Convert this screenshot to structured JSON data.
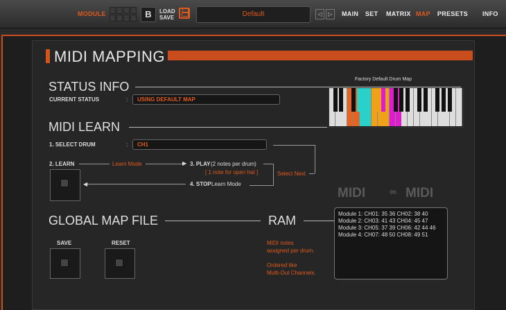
{
  "topbar": {
    "module_label": "MODULE",
    "load_label": "LOAD",
    "save_label": "SAVE",
    "preset_name": "Default",
    "prev_arrow": "◁",
    "next_arrow": "▷",
    "nav": [
      "MAIN",
      "SET",
      "MATRIX",
      "MAP",
      "PRESETS",
      "INFO"
    ],
    "active_nav": "MAP"
  },
  "page": {
    "title": "MIDI MAPPING"
  },
  "status": {
    "section": "STATUS INFO",
    "current_label": "CURRENT STATUS",
    "sep": ":",
    "current_value": "USING DEFAULT MAP",
    "map_title": "Factory Default Drum Map"
  },
  "learn": {
    "section": "MIDI LEARN",
    "select_drum_label": "1. SELECT DRUM",
    "sep": ":",
    "drum_value": "CH1",
    "learn_label": "2. LEARN",
    "learn_mode": "Learn Mode",
    "play_label": "3. PLAY",
    "play_note": "(2 notes per drum)",
    "open_hat_note": "[ 1 note for open hat ]",
    "select_next": "Select Next",
    "stop_label": "4. STOP",
    "stop_mode": "Learn Mode"
  },
  "logos": {
    "midi1": "MIDI",
    "midi2": "MIDI"
  },
  "global": {
    "section": "GLOBAL MAP FILE",
    "save": "SAVE",
    "reset": "RESET"
  },
  "ram": {
    "section": "RAM",
    "desc1": "MIDI notes",
    "desc2": "assigned per drum.",
    "desc3": "Ordered like",
    "desc4": "Multi-Out Channels.",
    "lines": [
      "Module 1: CH01: 35 36  CH02: 38 40",
      "Module 2: CH03: 41 43  CH04: 45 47",
      "Module 3: CH05: 37 39  CH06: 42 44 46",
      "Module 4: CH07: 48 50  CH08: 49 51"
    ]
  },
  "colors": {
    "accent": "#e05a1c",
    "keys_highlight": [
      "#e8631f",
      "#2ad1c9",
      "#f0a11a",
      "#e01ccf"
    ]
  }
}
